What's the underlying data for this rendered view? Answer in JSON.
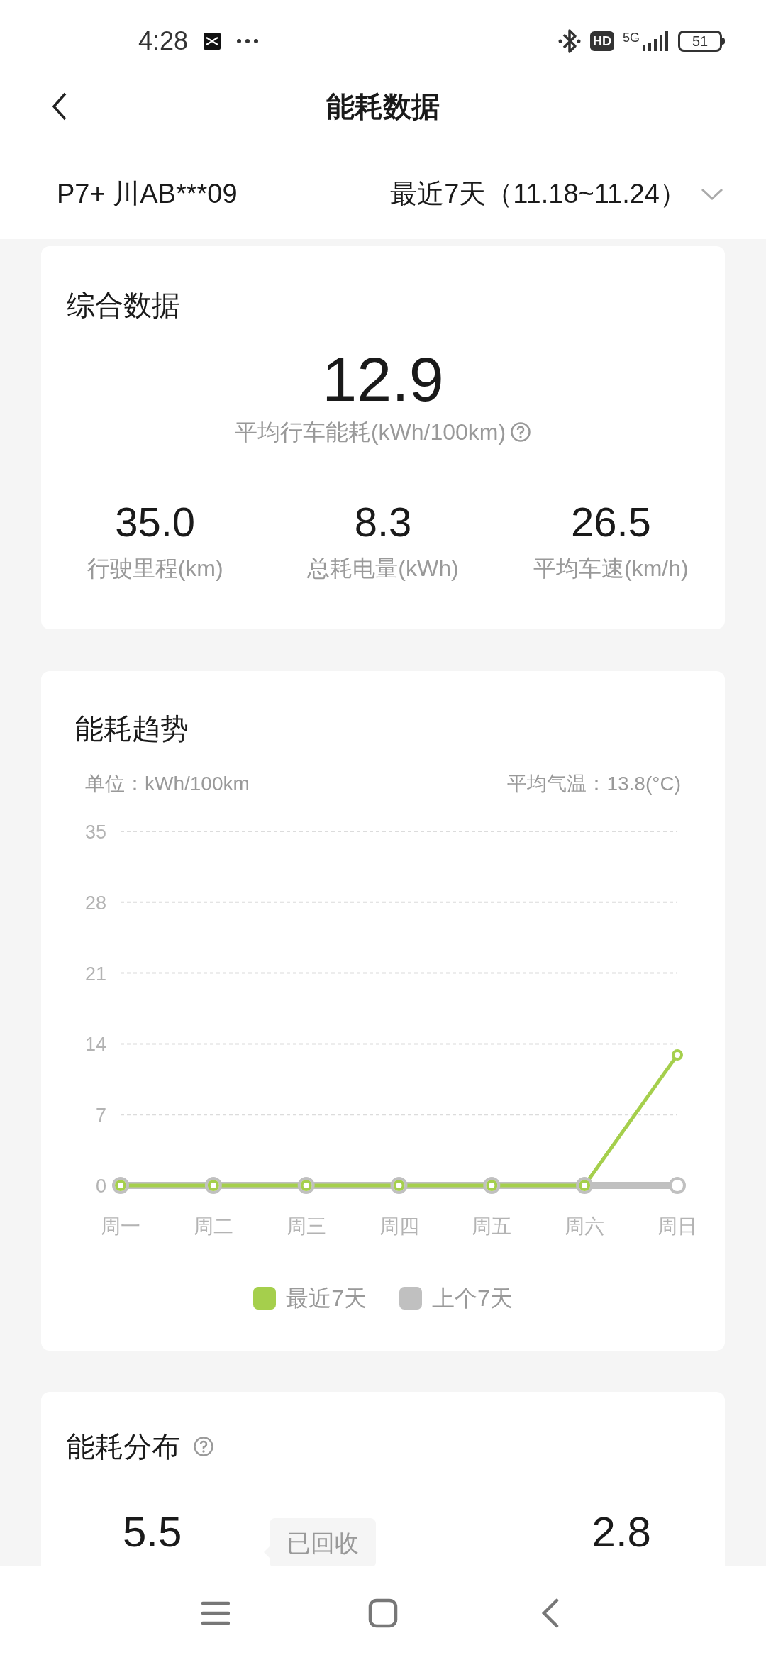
{
  "status_bar": {
    "time": "4:28",
    "hd_badge": "HD",
    "network": "5G",
    "battery": "51"
  },
  "header": {
    "title": "能耗数据"
  },
  "filter": {
    "vehicle": "P7+ 川AB***09",
    "period": "最近7天（11.18~11.24）"
  },
  "summary": {
    "title": "综合数据",
    "main": {
      "value": "12.9",
      "label": "平均行车能耗(kWh/100km)"
    },
    "stats": [
      {
        "value": "35.0",
        "label": "行驶里程(km)"
      },
      {
        "value": "8.3",
        "label": "总耗电量(kWh)"
      },
      {
        "value": "26.5",
        "label": "平均车速(km/h)"
      }
    ]
  },
  "trend": {
    "title": "能耗趋势",
    "unit": "单位：kWh/100km",
    "temperature": "平均气温：13.8(°C)",
    "chart_data": {
      "type": "line",
      "grid": true,
      "categories": [
        "周一",
        "周二",
        "周三",
        "周四",
        "周五",
        "周六",
        "周日"
      ],
      "ylim": [
        0,
        35
      ],
      "yticks": [
        0,
        7,
        14,
        21,
        28,
        35
      ],
      "series": [
        {
          "name": "最近7天",
          "color": "#a5cf4c",
          "marker": true,
          "values": [
            0,
            0,
            0,
            0,
            0,
            0,
            12.9
          ]
        },
        {
          "name": "上个7天",
          "color": "#c0c0c0",
          "marker": true,
          "values": [
            0,
            0,
            0,
            0,
            0,
            0,
            0
          ]
        }
      ]
    }
  },
  "distribution": {
    "title": "能耗分布",
    "values": [
      "5.5",
      "2.8"
    ],
    "tooltip": "已回收"
  }
}
